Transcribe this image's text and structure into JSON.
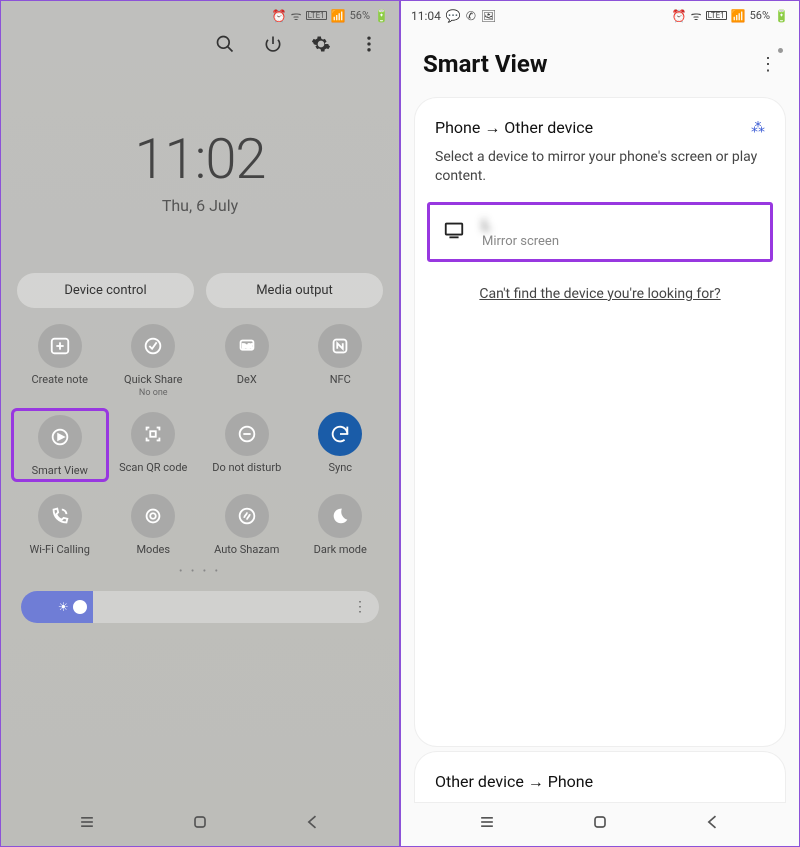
{
  "left": {
    "status": {
      "battery": "56%",
      "net": "LTE1"
    },
    "clock": {
      "time": "11:02",
      "date": "Thu, 6 July"
    },
    "pills": {
      "device_control": "Device control",
      "media_output": "Media output"
    },
    "tiles": [
      {
        "name": "create-note",
        "label": "Create note"
      },
      {
        "name": "quick-share",
        "label": "Quick Share",
        "sub": "No one"
      },
      {
        "name": "dex",
        "label": "DeX"
      },
      {
        "name": "nfc",
        "label": "NFC"
      },
      {
        "name": "smart-view",
        "label": "Smart View"
      },
      {
        "name": "scan-qr",
        "label": "Scan QR code"
      },
      {
        "name": "dnd",
        "label": "Do not disturb"
      },
      {
        "name": "sync",
        "label": "Sync"
      },
      {
        "name": "wifi-calling",
        "label": "Wi-Fi Calling"
      },
      {
        "name": "modes",
        "label": "Modes"
      },
      {
        "name": "auto-shazam",
        "label": "Auto Shazam"
      },
      {
        "name": "dark-mode",
        "label": "Dark mode"
      }
    ]
  },
  "right": {
    "status": {
      "time": "11:04",
      "battery": "56%",
      "net": "LTE1"
    },
    "title": "Smart View",
    "direction1": "Phone → Other device",
    "desc": "Select a device to mirror your phone's screen or play content.",
    "device": {
      "name": "L",
      "sub": "Mirror screen"
    },
    "help": "Can't find the device you're looking for?",
    "direction2": "Other device → Phone"
  }
}
